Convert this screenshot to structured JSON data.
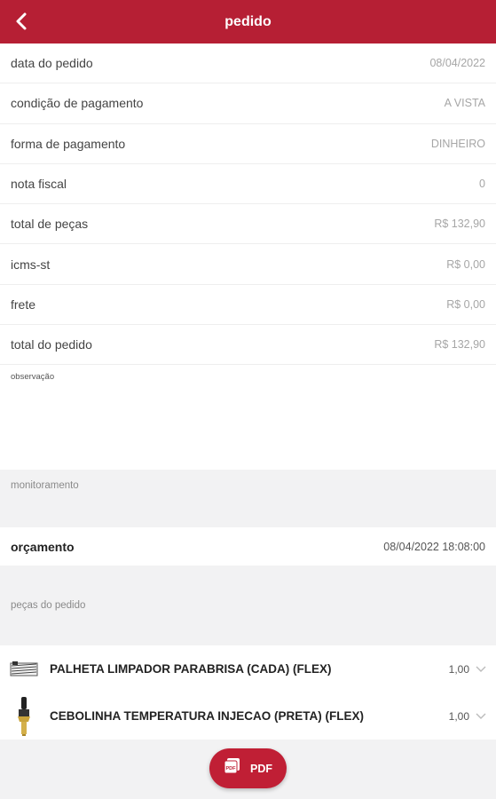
{
  "header": {
    "title": "pedido",
    "back_icon": "chevron-left-icon"
  },
  "details": [
    {
      "label": "data do pedido",
      "value": "08/04/2022"
    },
    {
      "label": "condição de pagamento",
      "value": "A VISTA"
    },
    {
      "label": "forma de pagamento",
      "value": "DINHEIRO"
    },
    {
      "label": "nota fiscal",
      "value": "0"
    },
    {
      "label": "total de peças",
      "value": "R$ 132,90"
    },
    {
      "label": "icms-st",
      "value": "R$ 0,00"
    },
    {
      "label": "frete",
      "value": "R$ 0,00"
    },
    {
      "label": "total do pedido",
      "value": "R$ 132,90"
    }
  ],
  "observation": {
    "label": "observação"
  },
  "monitoring": {
    "label": "monitoramento",
    "row": {
      "name": "orçamento",
      "date": "08/04/2022 18:08:00"
    }
  },
  "parts": {
    "label": "peças do pedido",
    "items": [
      {
        "name": "PALHETA LIMPADOR PARABRISA (CADA) (FLEX)",
        "qty": "1,00",
        "icon": "wiper-blade-icon"
      },
      {
        "name": "CEBOLINHA TEMPERATURA INJECAO (PRETA) (FLEX)",
        "qty": "1,00",
        "icon": "temperature-sensor-icon"
      }
    ]
  },
  "pdf_button": {
    "label": "PDF",
    "icon": "pdf-file-icon"
  },
  "colors": {
    "brand": "#b61f34",
    "background": "#f2f2f3"
  }
}
